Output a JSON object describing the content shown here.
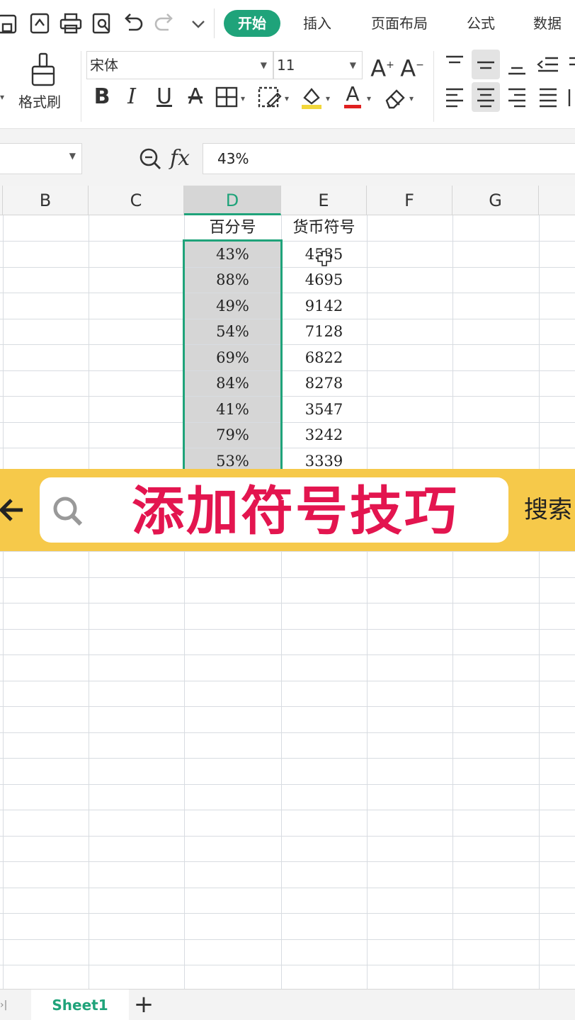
{
  "toolbar": {
    "tabs": [
      "开始",
      "插入",
      "页面布局",
      "公式",
      "数据"
    ]
  },
  "ribbon": {
    "format_painter_label": "格式刷",
    "font_name": "宋体",
    "font_size": "11"
  },
  "formula_bar": {
    "fx_label": "fx",
    "value": "43%"
  },
  "grid": {
    "columns": [
      "B",
      "C",
      "D",
      "E",
      "F",
      "G"
    ],
    "selected_column": "D",
    "headers": {
      "D": "百分号",
      "E": "货币符号"
    },
    "percent_values": [
      "43%",
      "88%",
      "49%",
      "54%",
      "69%",
      "84%",
      "41%",
      "79%",
      "53%"
    ],
    "currency_values": [
      "4535",
      "4695",
      "9142",
      "7128",
      "6822",
      "8278",
      "3547",
      "3242",
      "3339"
    ]
  },
  "banner": {
    "title": "添加符号技巧",
    "right_text": "搜索"
  },
  "sheets": {
    "active": "Sheet1",
    "add_label": "+"
  },
  "colors": {
    "accent": "#1fa37a",
    "banner_bg": "#f6c94a",
    "banner_title": "#e3154f"
  }
}
